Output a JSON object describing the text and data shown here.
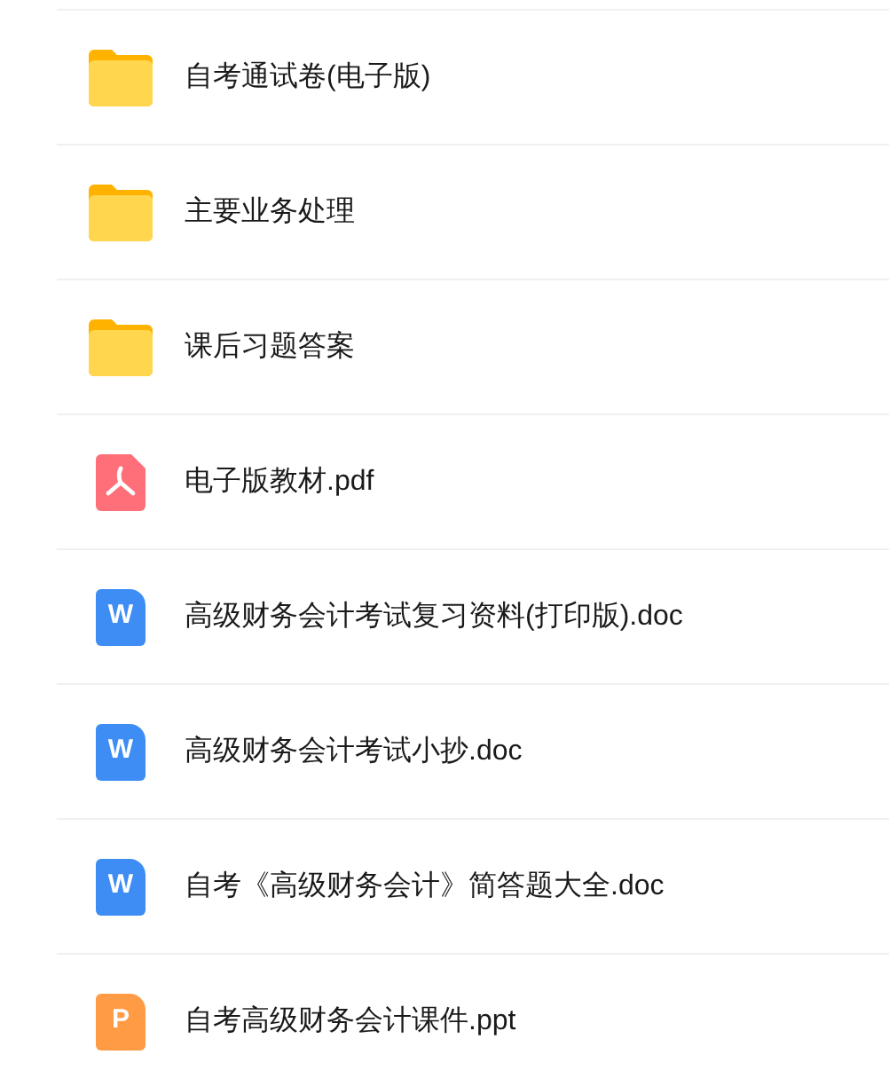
{
  "files": [
    {
      "kind": "folder",
      "name": "自考通试卷(电子版)"
    },
    {
      "kind": "folder",
      "name": "主要业务处理"
    },
    {
      "kind": "folder",
      "name": "课后习题答案"
    },
    {
      "kind": "pdf",
      "name": "电子版教材.pdf"
    },
    {
      "kind": "doc",
      "icon_label": "W",
      "name": "高级财务会计考试复习资料(打印版).doc"
    },
    {
      "kind": "doc",
      "icon_label": "W",
      "name": "高级财务会计考试小抄.doc"
    },
    {
      "kind": "doc",
      "icon_label": "W",
      "name": "自考《高级财务会计》简答题大全.doc"
    },
    {
      "kind": "ppt",
      "icon_label": "P",
      "name": "自考高级财务会计课件.ppt"
    }
  ]
}
